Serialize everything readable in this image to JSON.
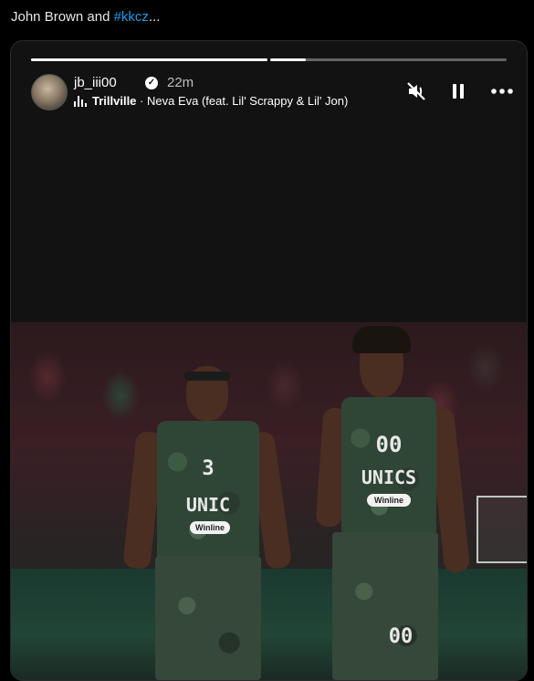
{
  "post": {
    "text_prefix": "John Brown and ",
    "hashtag": "#kkcz",
    "ellipsis": "..."
  },
  "story": {
    "progress": [
      1.0,
      0.15
    ],
    "username": "jb_iii00",
    "verified_icon": "verified-check-icon",
    "time": "22m",
    "music": {
      "icon": "music-bars-icon",
      "artist": "Trillville",
      "separator": " · ",
      "title": "Neva Eva (feat. Lil' Scrappy & Lil' Jon)"
    },
    "controls": [
      "mute-icon",
      "pause-icon",
      "more-icon"
    ]
  },
  "photo": {
    "player_left": {
      "number": "3",
      "team": "UNIC",
      "sponsor": "Winline"
    },
    "player_right": {
      "number": "00",
      "team": "UNICS",
      "sponsor": "Winline",
      "shorts_number": "00"
    }
  }
}
